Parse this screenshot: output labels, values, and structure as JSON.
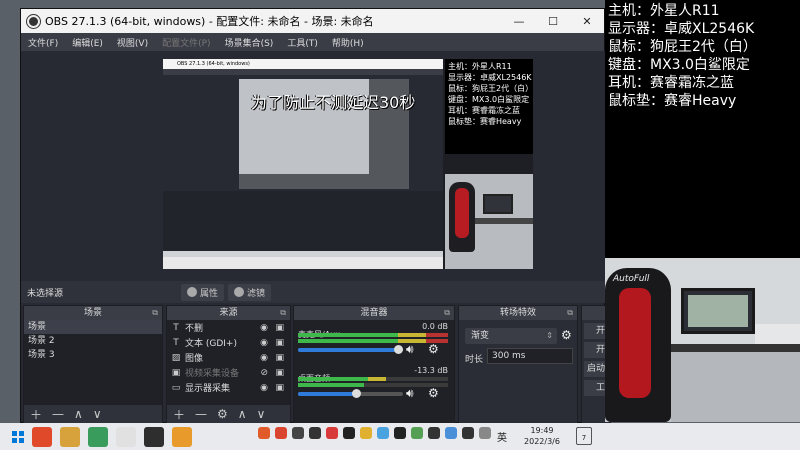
{
  "obs": {
    "title": "OBS 27.1.3 (64-bit, windows) - 配置文件: 未命名 - 场景: 未命名",
    "menu": [
      "文件(F)",
      "编辑(E)",
      "视图(V)",
      "配置文件(P)",
      "场景集合(S)",
      "工具(T)",
      "帮助(H)"
    ],
    "overlay_warning": "为了防止不测延迟30秒",
    "nested_title": "OBS 27.1.3 (64-bit, windows)",
    "source_bar": {
      "no_selection": "未选择源",
      "properties": "属性",
      "filters": "滤镜"
    },
    "docks": {
      "scenes": {
        "title": "场景",
        "items": [
          "场景",
          "场景 2",
          "场景 3"
        ]
      },
      "sources": {
        "title": "来源",
        "items": [
          {
            "label": "不删",
            "icon": "text-icon",
            "hidden": false
          },
          {
            "label": "文本 (GDI+)",
            "icon": "text-icon",
            "hidden": false
          },
          {
            "label": "图像",
            "icon": "image-icon",
            "hidden": false
          },
          {
            "label": "视频采集设备",
            "icon": "camera-icon",
            "hidden": true
          },
          {
            "label": "显示器采集",
            "icon": "monitor-icon",
            "hidden": false
          }
        ]
      },
      "mixer": {
        "title": "混音器",
        "channels": [
          {
            "name": "麦克风/Aux",
            "db": "0.0 dB",
            "volume": 0.95
          },
          {
            "name": "桌面音频",
            "db": "-13.3 dB",
            "volume": 0.55
          }
        ]
      },
      "transitions": {
        "title": "转场特效",
        "selected": "渐变",
        "duration_label": "时长",
        "duration_value": "300 ms"
      },
      "controls": {
        "items": [
          "开",
          "开",
          "启动",
          "工"
        ]
      }
    }
  },
  "info_panel": {
    "lines": [
      "主机：外星人R11",
      "显示器：卓威XL2546K",
      "鼠标：狗屁王2代（白）",
      "键盘：MX3.0白鲨限定",
      "耳机：赛睿霜冻之蓝",
      "鼠标垫：赛睿Heavy"
    ]
  },
  "nested_info_lines": [
    "主机：外星人R11",
    "显示器：卓威XL2546K",
    "鼠标：狗屁王2代（白）",
    "键盘：MX3.0白鲨限定",
    "耳机：赛睿霜冻之蓝",
    "鼠标垫：赛睿Heavy"
  ],
  "cam": {
    "chair_brand": "AutoFull"
  },
  "taskbar": {
    "lang": "英",
    "time": "19:49",
    "date": "2022/3/6",
    "notif_count": "7",
    "app_colors": [
      "#e04a2a",
      "#d7a23b",
      "#3a9c5c",
      "#e1e1e1",
      "#2e2e2e",
      "#e89a2b"
    ],
    "tray_colors": [
      "#e05a2a",
      "#d9452e",
      "#444444",
      "#333333",
      "#d83a3a",
      "#222222",
      "#e0b030",
      "#4aa3df",
      "#222222",
      "#55a055",
      "#333333",
      "#4a90d9",
      "#333333",
      "#888888"
    ]
  }
}
